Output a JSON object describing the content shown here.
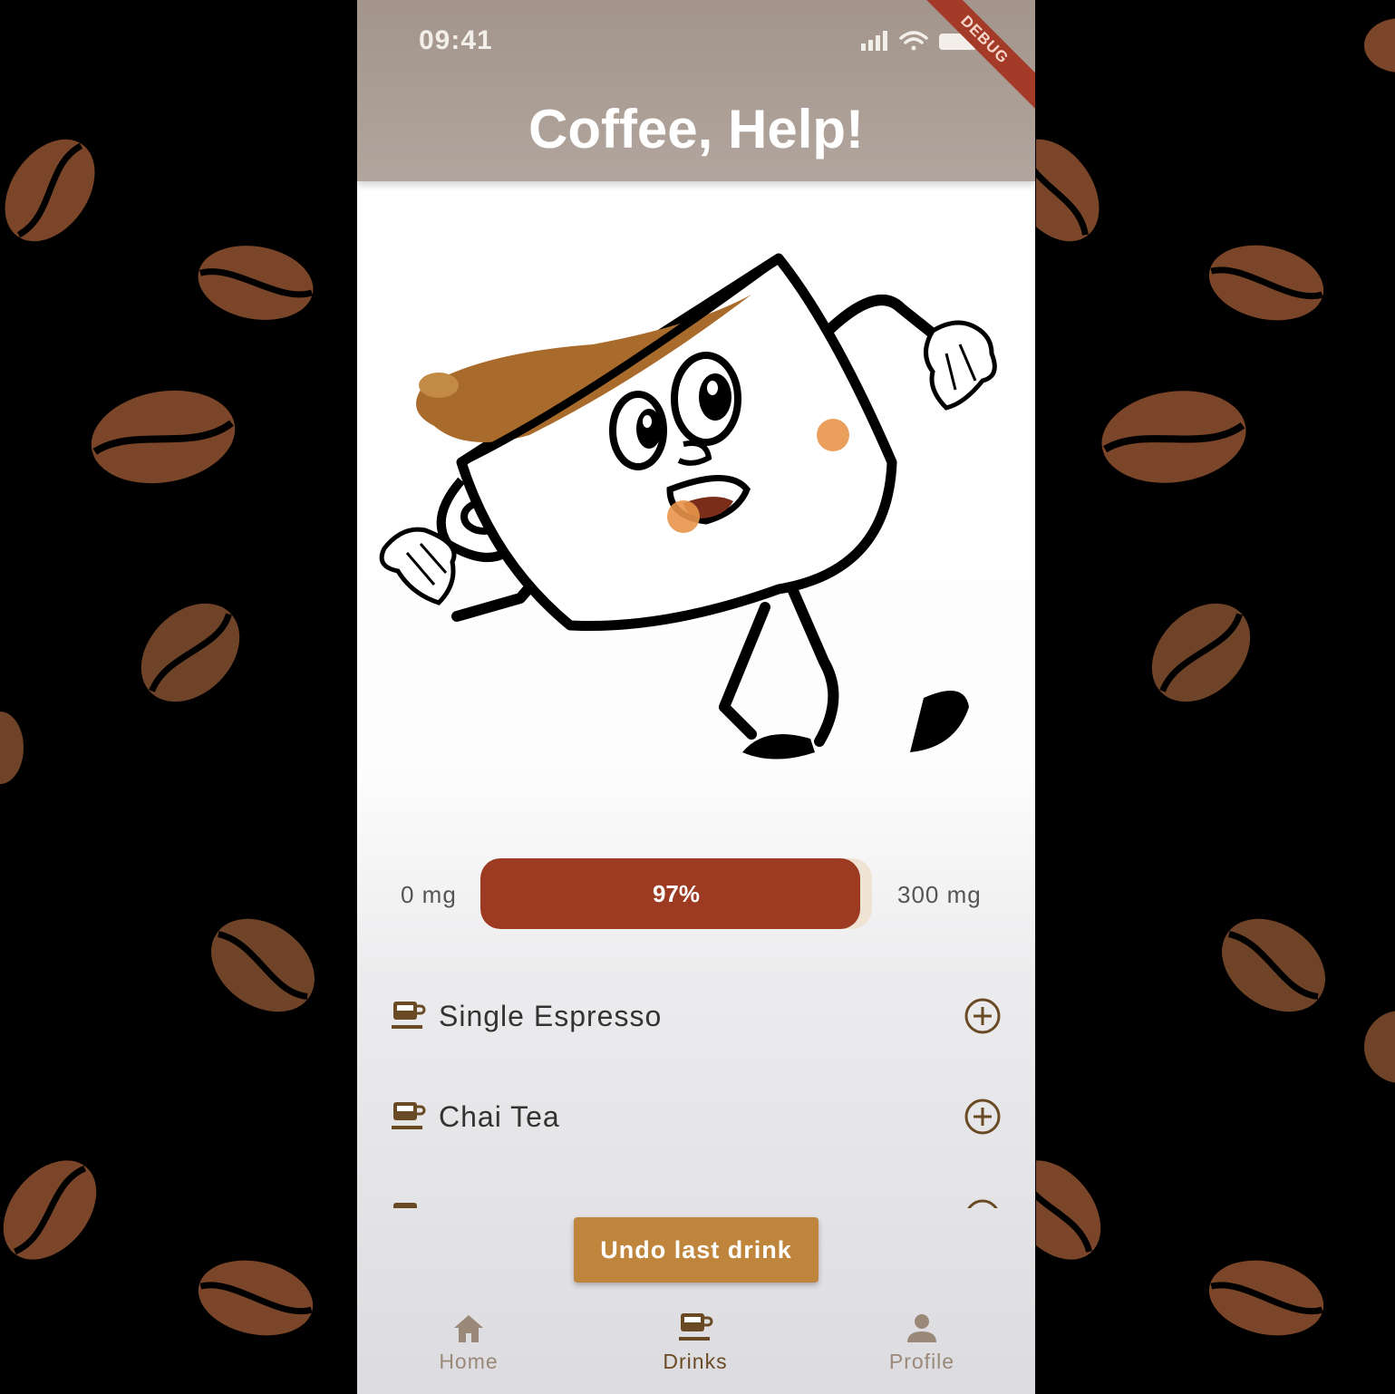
{
  "status_bar": {
    "time": "09:41"
  },
  "debug_banner": "DEBUG",
  "app_bar": {
    "title": "Coffee, Help!"
  },
  "caffeine_meter": {
    "min_label": "0 mg",
    "max_label": "300 mg",
    "percent_label": "97%",
    "fill_fraction": 0.97
  },
  "drinks": [
    {
      "name": "Single Espresso",
      "icon": "coffee-cup-icon",
      "action_icon": "add-circle-icon"
    },
    {
      "name": "Chai Tea",
      "icon": "coffee-cup-icon",
      "action_icon": "add-circle-icon"
    }
  ],
  "undo_button": {
    "label": "Undo last drink"
  },
  "bottom_nav": [
    {
      "label": "Home",
      "icon": "home-icon",
      "selected": false
    },
    {
      "label": "Drinks",
      "icon": "coffee-cup-icon",
      "selected": true
    },
    {
      "label": "Profile",
      "icon": "person-icon",
      "selected": false
    }
  ],
  "colors": {
    "app_bar": "#a3958b",
    "progress_fill": "#9d3a22",
    "progress_track": "#efe3d3",
    "accent_button": "#bf853c",
    "icon_brown": "#6a4a24",
    "bean": "#7a4528",
    "background": "#000000"
  }
}
